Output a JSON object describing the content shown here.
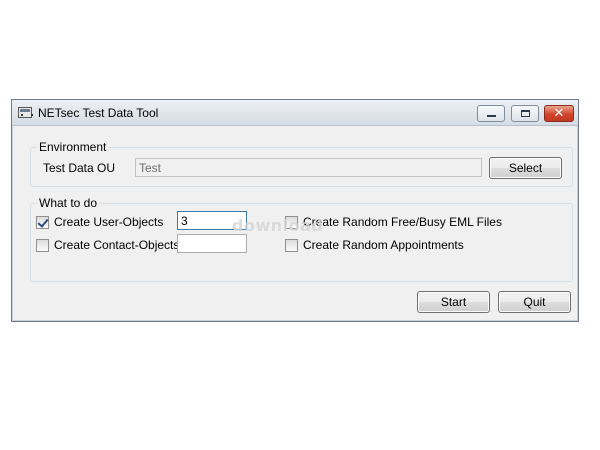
{
  "window": {
    "title": "NETsec Test Data Tool",
    "controls": {
      "minimize_icon": "minimize-icon",
      "maximize_icon": "maximize-icon",
      "close_glyph": "✕"
    }
  },
  "environment": {
    "group_label": "Environment",
    "ou_label": "Test Data OU",
    "ou_value": "Test",
    "select_label": "Select"
  },
  "what_to_do": {
    "group_label": "What to do",
    "user_objects": {
      "label": "Create User-Objects",
      "checked": true,
      "count": "3"
    },
    "contact_objects": {
      "label": "Create Contact-Objects",
      "checked": false,
      "count": ""
    },
    "free_busy": {
      "label": "Create Random Free/Busy EML Files",
      "checked": false
    },
    "appointments": {
      "label": "Create Random Appointments",
      "checked": false
    }
  },
  "buttons": {
    "start": "Start",
    "quit": "Quit"
  },
  "watermark": "download",
  "colors": {
    "close_button": "#d1452b",
    "window_border": "#6f7b8a",
    "dialog_bg": "#f0f0f0"
  }
}
